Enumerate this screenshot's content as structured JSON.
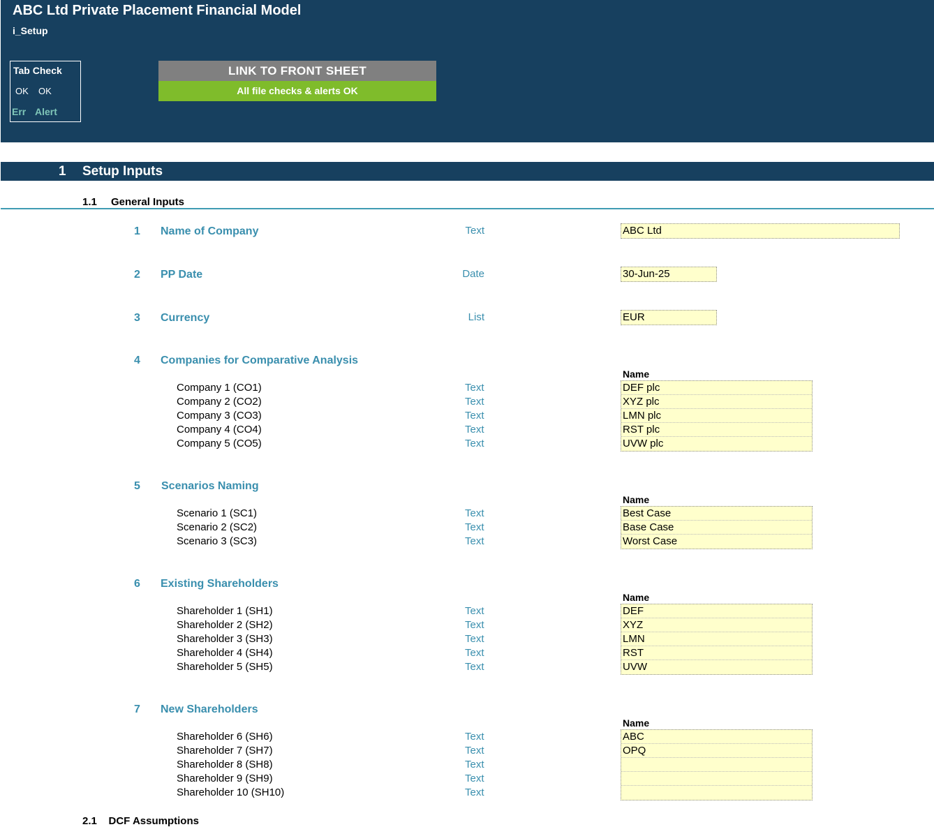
{
  "header": {
    "title": "ABC Ltd Private Placement Financial Model",
    "sheet": "i_Setup",
    "tab_check": {
      "label": "Tab Check",
      "ok1": "OK",
      "ok2": "OK",
      "err": "Err",
      "alert": "Alert"
    },
    "link_button": "LINK TO FRONT SHEET",
    "checks_status": "All file checks & alerts OK"
  },
  "colors": {
    "header_bg": "#17405f",
    "accent_teal": "#3a8fae",
    "input_fill": "#ffffcc",
    "ok_green": "#7fbc2b",
    "button_grey": "#808080",
    "tabcheck_muted": "#7fc6b8"
  },
  "section": {
    "number": "1",
    "title": "Setup Inputs"
  },
  "subsection": {
    "number": "1.1",
    "title": "General Inputs"
  },
  "items": {
    "company": {
      "num": "1",
      "label": "Name of Company",
      "type": "Text",
      "value": "ABC Ltd"
    },
    "pp_date": {
      "num": "2",
      "label": "PP Date",
      "type": "Date",
      "value": "30-Jun-25"
    },
    "currency": {
      "num": "3",
      "label": "Currency",
      "type": "List",
      "value": "EUR"
    },
    "comparatives": {
      "num": "4",
      "label": "Companies  for Comparative Analysis",
      "header": "Name",
      "rows": [
        {
          "label": "Company 1 (CO1)",
          "type": "Text",
          "value": "DEF plc"
        },
        {
          "label": "Company 2 (CO2)",
          "type": "Text",
          "value": "XYZ plc"
        },
        {
          "label": "Company 3 (CO3)",
          "type": "Text",
          "value": "LMN plc"
        },
        {
          "label": "Company 4 (CO4)",
          "type": "Text",
          "value": "RST plc"
        },
        {
          "label": "Company 5 (CO5)",
          "type": "Text",
          "value": "UVW plc"
        }
      ]
    },
    "scenarios": {
      "num": "5",
      "label": "Scenarios Naming",
      "header": "Name",
      "rows": [
        {
          "label": "Scenario 1 (SC1)",
          "type": "Text",
          "value": "Best Case"
        },
        {
          "label": "Scenario 2 (SC2)",
          "type": "Text",
          "value": "Base Case"
        },
        {
          "label": "Scenario 3 (SC3)",
          "type": "Text",
          "value": "Worst Case"
        }
      ]
    },
    "existing": {
      "num": "6",
      "label": "Existing Shareholders",
      "header": "Name",
      "rows": [
        {
          "label": "Shareholder 1 (SH1)",
          "type": "Text",
          "value": "DEF"
        },
        {
          "label": "Shareholder 2 (SH2)",
          "type": "Text",
          "value": "XYZ"
        },
        {
          "label": "Shareholder 3 (SH3)",
          "type": "Text",
          "value": "LMN"
        },
        {
          "label": "Shareholder 4 (SH4)",
          "type": "Text",
          "value": "RST"
        },
        {
          "label": "Shareholder 5 (SH5)",
          "type": "Text",
          "value": "UVW"
        }
      ]
    },
    "new": {
      "num": "7",
      "label": "New Shareholders",
      "header": "Name",
      "rows": [
        {
          "label": "Shareholder 6 (SH6)",
          "type": "Text",
          "value": "ABC"
        },
        {
          "label": "Shareholder 7 (SH7)",
          "type": "Text",
          "value": "OPQ"
        },
        {
          "label": "Shareholder 8 (SH8)",
          "type": "Text",
          "value": ""
        },
        {
          "label": "Shareholder 9 (SH9)",
          "type": "Text",
          "value": ""
        },
        {
          "label": "Shareholder 10 (SH10)",
          "type": "Text",
          "value": ""
        }
      ]
    }
  },
  "next_subsection_partial": "2.1    DCF Assumptions"
}
